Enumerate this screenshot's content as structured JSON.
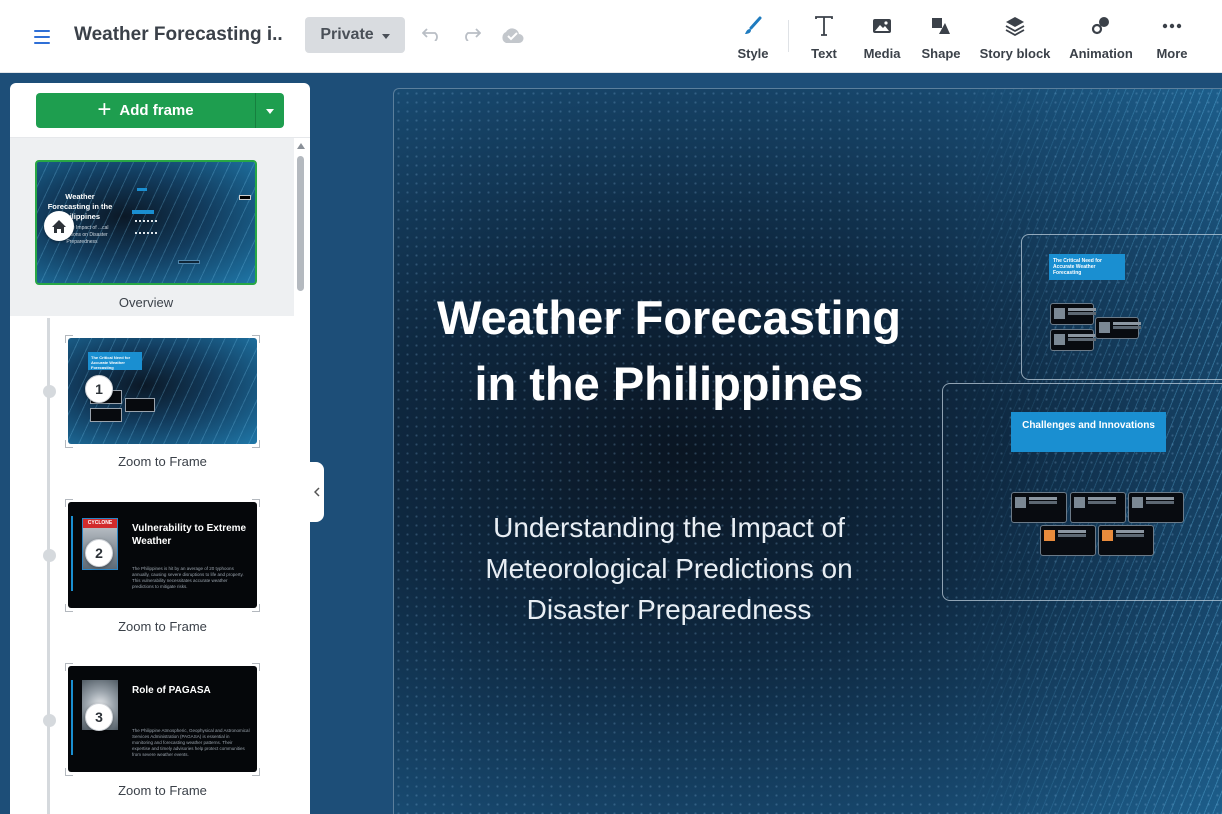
{
  "header": {
    "doc_title": "Weather Forecasting i...",
    "privacy": "Private",
    "tools": [
      {
        "name": "style",
        "label": "Style"
      },
      {
        "name": "text",
        "label": "Text"
      },
      {
        "name": "media",
        "label": "Media"
      },
      {
        "name": "shape",
        "label": "Shape"
      },
      {
        "name": "story-block",
        "label": "Story block"
      },
      {
        "name": "animation",
        "label": "Animation"
      },
      {
        "name": "more",
        "label": "More"
      }
    ]
  },
  "panel": {
    "add_frame_label": "Add frame",
    "overview": {
      "caption": "Overview",
      "thumb_title": "Weather Forecasting in the Philippines",
      "thumb_subtitle": "...ing the Impact of ...cal Predictions on Disaster Preparedness"
    },
    "frames": [
      {
        "number": "1",
        "caption": "Zoom to Frame",
        "tag": "The Critical Need for Accurate Weather Forecasting"
      },
      {
        "number": "2",
        "caption": "Zoom to Frame",
        "heading": "Vulnerability to Extreme Weather",
        "image_label": "CYCLONE",
        "body": "The Philippines is hit by an average of 20 typhoons annually, causing severe disruptions to life and property. This vulnerability necessitates accurate weather predictions to mitigate risks."
      },
      {
        "number": "3",
        "caption": "Zoom to Frame",
        "heading": "Role of PAGASA",
        "body": "The Philippine Atmospheric, Geophysical and Astronomical Services Administration (PAGASA) is essential in monitoring and forecasting weather patterns. Their expertise and timely advisories help protect communities from severe weather events."
      }
    ]
  },
  "canvas": {
    "title": "Weather Forecasting in the Philippines",
    "subtitle": "Understanding the Impact of Meteorological Predictions on Disaster Preparedness",
    "topic_1": "The Critical Need for Accurate Weather Forecasting",
    "topic_2": "Challenges and Innovations"
  },
  "colors": {
    "accent_green": "#1e9e4f",
    "tag_blue": "#1a8fd1",
    "cyclone_red": "#d22b2b"
  }
}
